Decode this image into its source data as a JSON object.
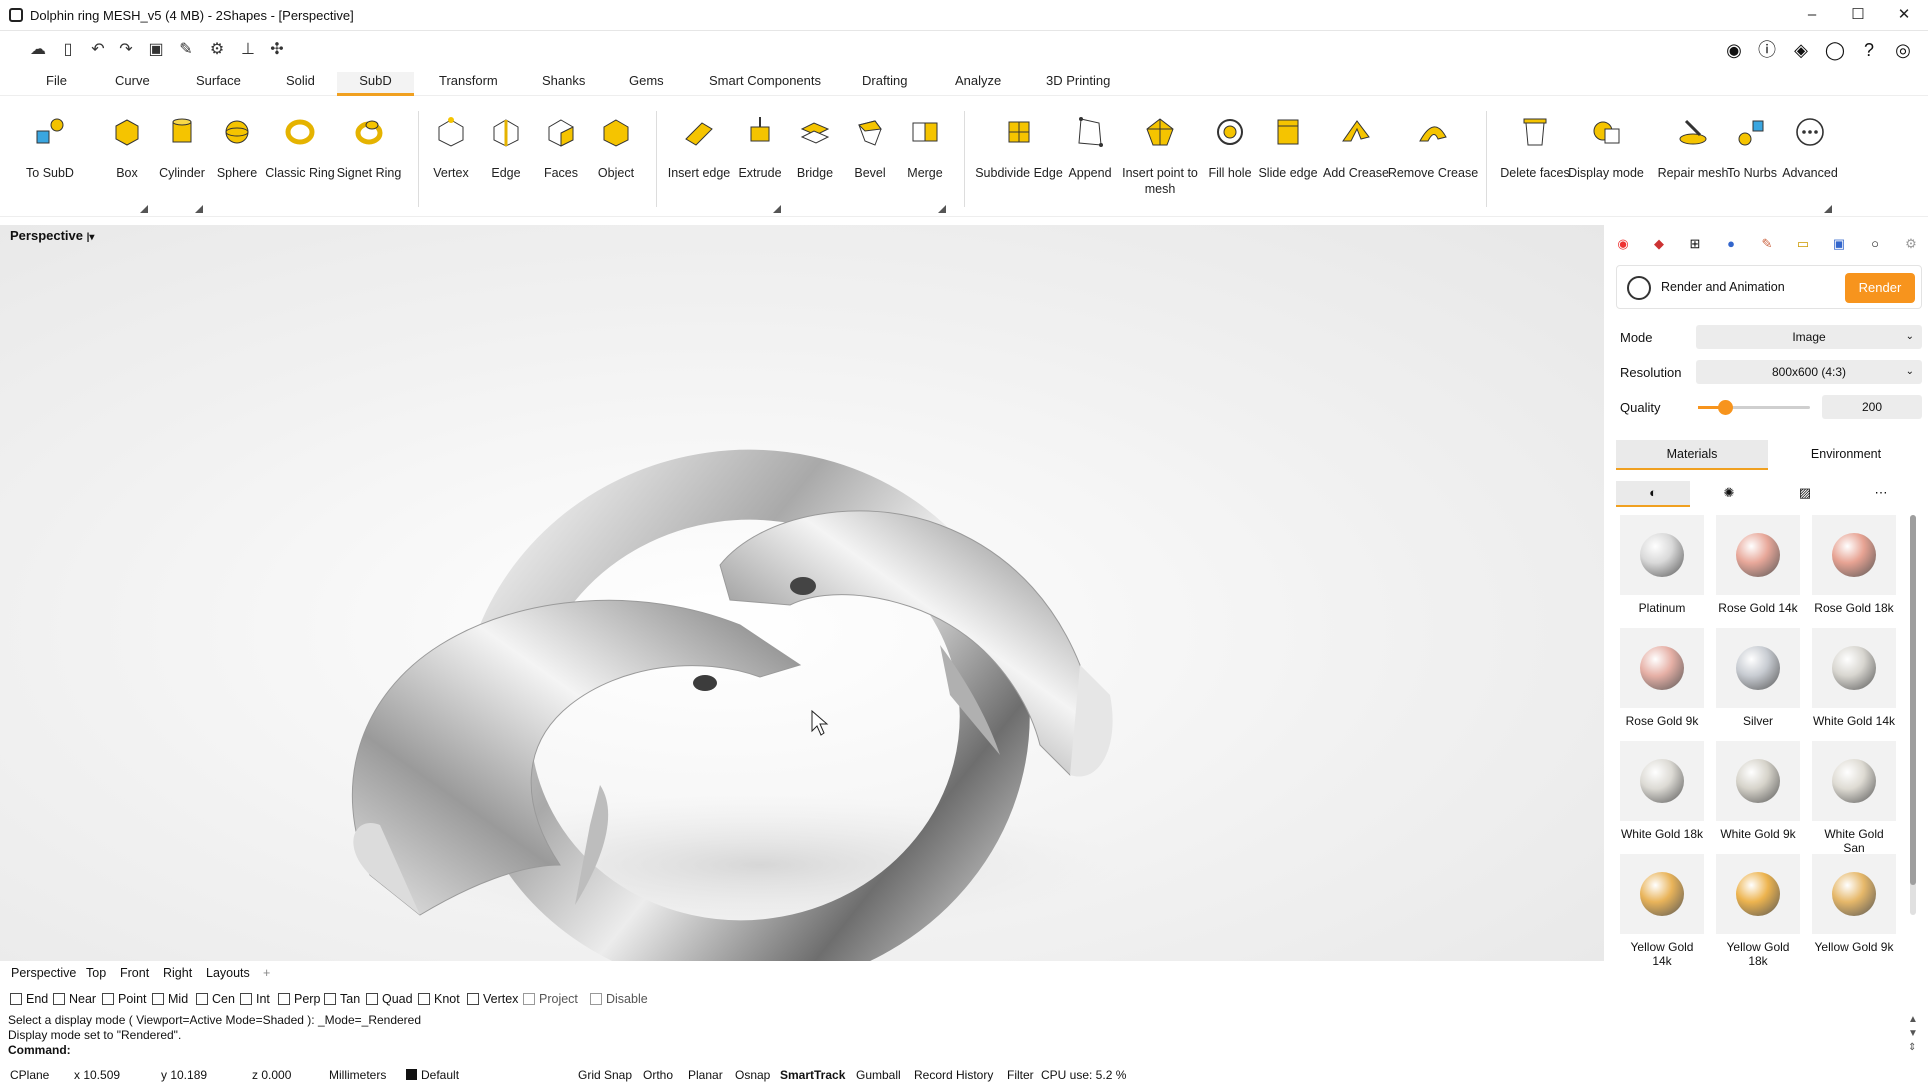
{
  "window": {
    "title": "Dolphin ring MESH_v5 (4 MB) - 2Shapes - [Perspective]",
    "minimize": "–",
    "maximize": "☐",
    "close": "✕"
  },
  "menu_tabs": [
    "File",
    "Curve",
    "Surface",
    "Solid",
    "SubD",
    "Transform",
    "Shanks",
    "Gems",
    "Smart Components",
    "Drafting",
    "Analyze",
    "3D Printing"
  ],
  "active_tab": "SubD",
  "ribbon": {
    "tools": [
      "To SubD",
      "Box",
      "Cylinder",
      "Sphere",
      "Classic Ring",
      "Signet Ring",
      "Vertex",
      "Edge",
      "Faces",
      "Object",
      "Insert edge",
      "Extrude",
      "Bridge",
      "Bevel",
      "Merge",
      "Subdivide Edge",
      "Append",
      "Insert point to mesh",
      "Fill hole",
      "Slide edge",
      "Add Crease",
      "Remove Crease",
      "Delete faces",
      "Display mode",
      "Repair mesh",
      "To Nurbs",
      "Advanced"
    ]
  },
  "viewport": {
    "name": "Perspective"
  },
  "render_panel": {
    "title": "Render and Animation",
    "render_button": "Render",
    "mode_label": "Mode",
    "mode_value": "Image",
    "resolution_label": "Resolution",
    "resolution_value": "800x600 (4:3)",
    "quality_label": "Quality",
    "quality_value": "200",
    "quality_fraction": 0.24,
    "tabs": [
      "Materials",
      "Environment"
    ],
    "materials": [
      {
        "name": "Platinum",
        "color": "#d9d9d9"
      },
      {
        "name": "Rose Gold 14k",
        "color": "#e8a89a"
      },
      {
        "name": "Rose Gold 18k",
        "color": "#e7a393"
      },
      {
        "name": "Rose Gold 9k",
        "color": "#e6b0a6"
      },
      {
        "name": "Silver",
        "color": "#c8ccd2"
      },
      {
        "name": "White Gold 14k",
        "color": "#d8d6d0"
      },
      {
        "name": "White Gold 18k",
        "color": "#dcdad4"
      },
      {
        "name": "White Gold 9k",
        "color": "#d6d3ca"
      },
      {
        "name": "White Gold San",
        "color": "#dedbd3"
      },
      {
        "name": "Yellow Gold 14k",
        "color": "#e9b45a"
      },
      {
        "name": "Yellow Gold 18k",
        "color": "#edb44f"
      },
      {
        "name": "Yellow Gold 9k",
        "color": "#e6b86a"
      }
    ]
  },
  "view_tabs": [
    "Perspective",
    "Top",
    "Front",
    "Right",
    "Layouts"
  ],
  "add_tab": "+",
  "osnaps": [
    "End",
    "Near",
    "Point",
    "Mid",
    "Cen",
    "Int",
    "Perp",
    "Tan",
    "Quad",
    "Knot",
    "Vertex",
    "Project",
    "Disable"
  ],
  "command": {
    "line1": "Select a display mode ( Viewport=Active  Mode=Shaded ): _Mode=_Rendered",
    "line2": "Display mode set to \"Rendered\".",
    "prompt": "Command:"
  },
  "status": {
    "cplane": "CPlane",
    "x": "x 10.509",
    "y": "y 10.189",
    "z": "z 0.000",
    "units": "Millimeters",
    "layer": "Default",
    "items": [
      "Grid Snap",
      "Ortho",
      "Planar",
      "Osnap",
      "SmartTrack",
      "Gumball",
      "Record History",
      "Filter"
    ],
    "cpu": "CPU use: 5.2 %"
  },
  "colors": {
    "accent": "#f0a020",
    "render_button": "#f7941d"
  }
}
